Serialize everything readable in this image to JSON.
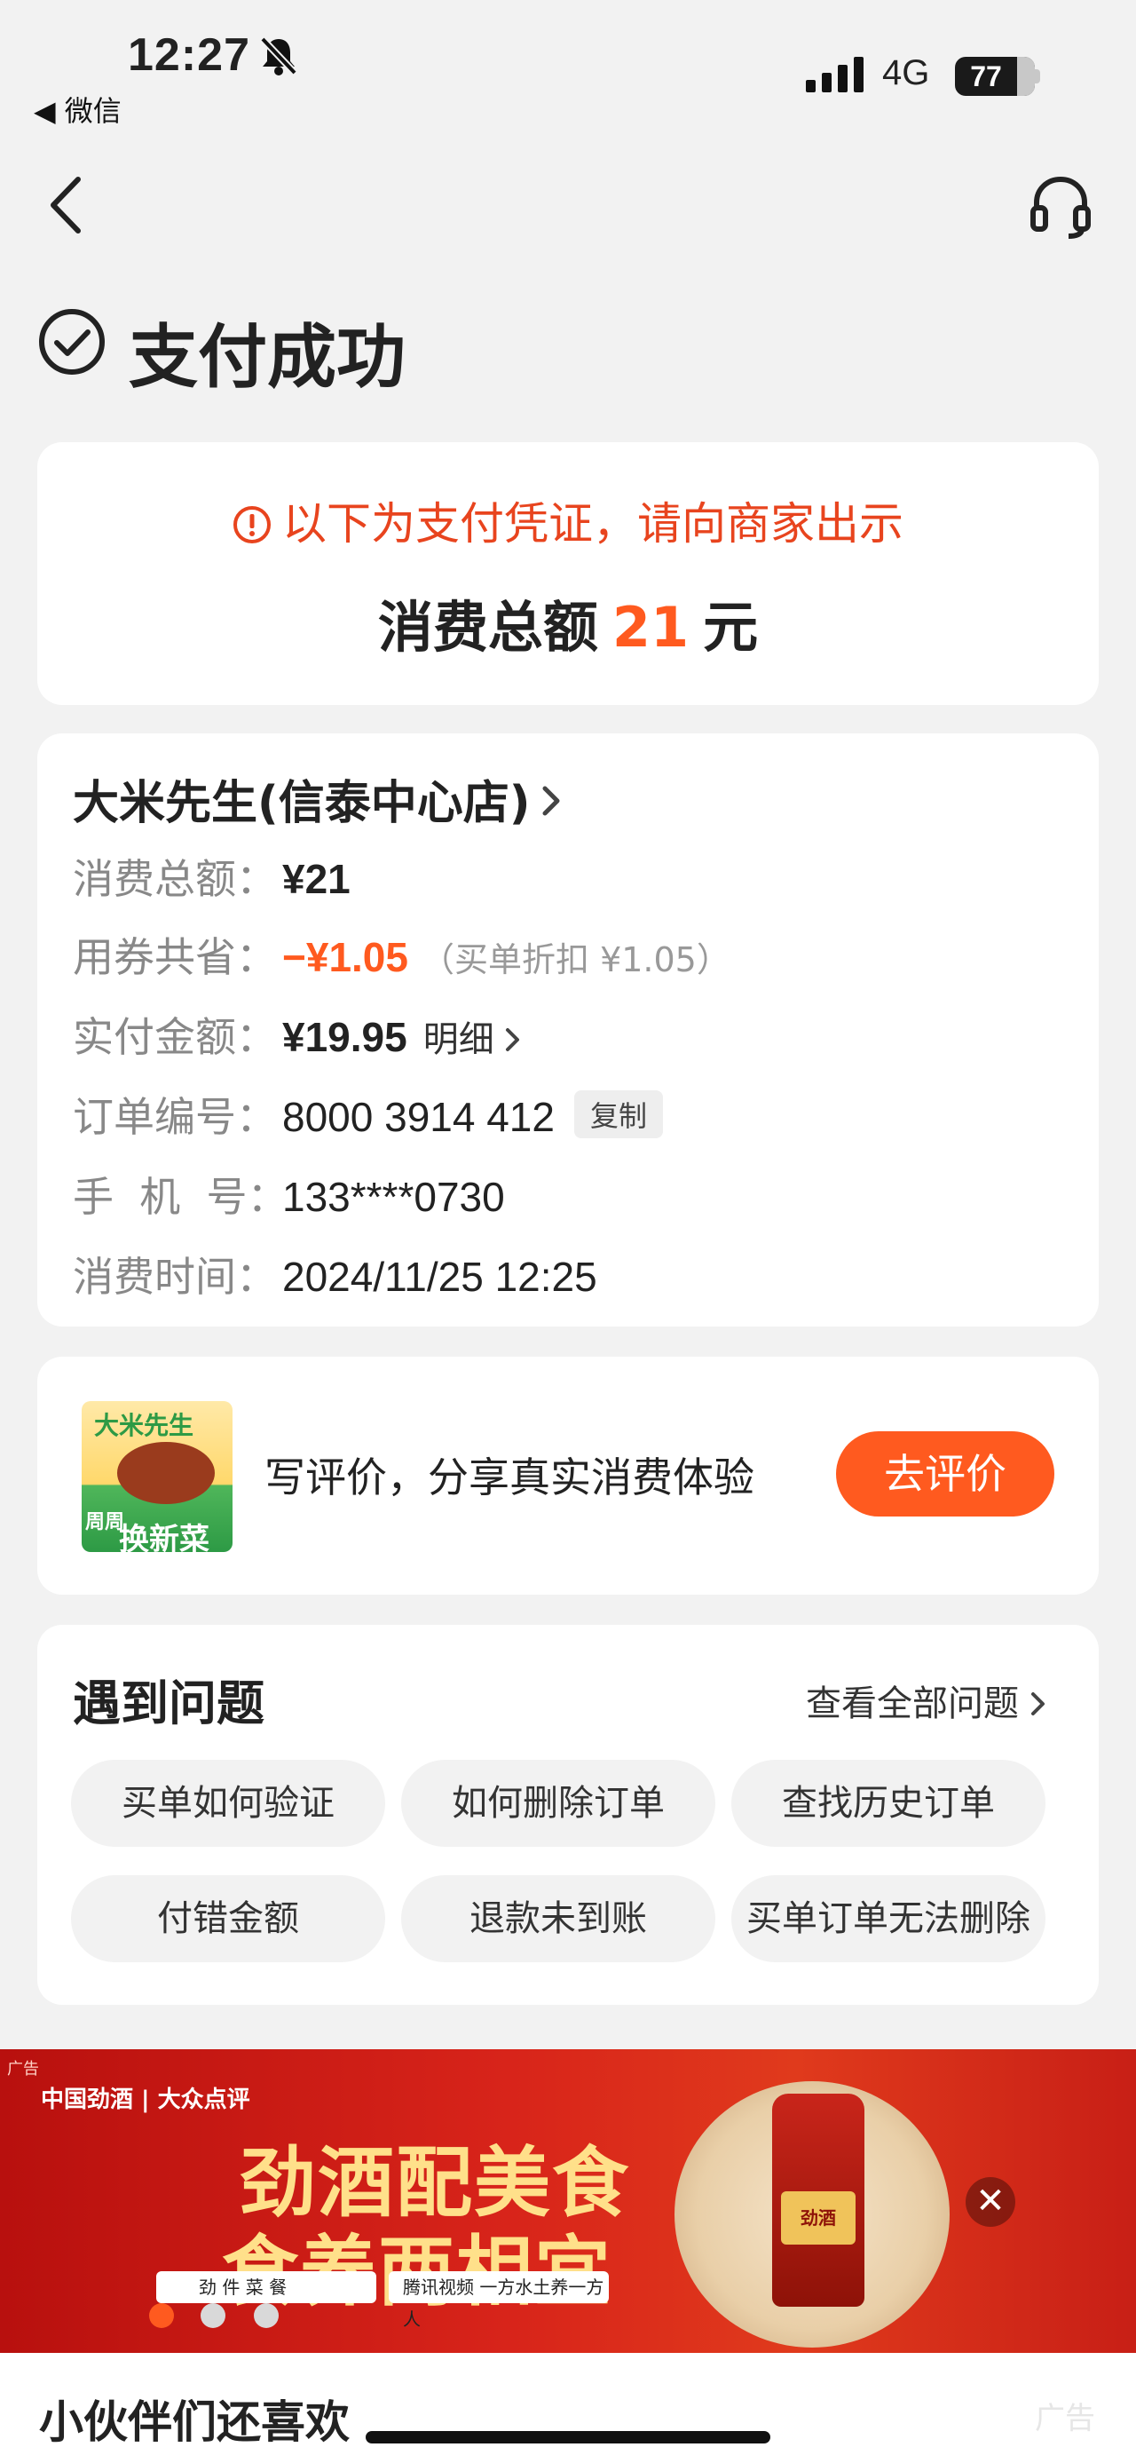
{
  "status_bar": {
    "time": "12:27",
    "back_app": "◀ 微信",
    "network": "4G",
    "battery": "77"
  },
  "page": {
    "title": "支付成功"
  },
  "voucher": {
    "notice": "以下为支付凭证，请向商家出示",
    "total_label": "消费总额",
    "total_amount": "21",
    "total_unit": "元"
  },
  "order": {
    "shop_name": "大米先生(信泰中心店)",
    "rows": {
      "total": {
        "label": "消费总额：",
        "value": "¥21"
      },
      "coupon": {
        "label": "用券共省：",
        "value": "−¥1.05",
        "note": "（买单折扣 ¥1.05）"
      },
      "paid": {
        "label": "实付金额：",
        "value": "¥19.95",
        "detail": "明细"
      },
      "order_no": {
        "label": "订单编号：",
        "value": "8000 3914 412",
        "copy": "复制"
      },
      "phone": {
        "label": "手  机  号：",
        "value": "133****0730"
      },
      "time": {
        "label": "消费时间：",
        "value": "2024/11/25 12:25"
      }
    }
  },
  "review": {
    "thumb_brand": "大米先生",
    "thumb_tag": "周周",
    "thumb_slogan": "换新菜",
    "text": "写评价，分享真实消费体验",
    "button": "去评价"
  },
  "issues": {
    "title": "遇到问题",
    "view_all": "查看全部问题",
    "chips": [
      "买单如何验证",
      "如何删除订单",
      "查找历史订单",
      "付错金额",
      "退款未到账",
      "买单订单无法删除"
    ]
  },
  "ad": {
    "tag": "广告",
    "brands": "中国劲酒 | 大众点评",
    "headline1": "劲酒配美食",
    "headline2": "食养两相宜",
    "search1": "劲 件 菜 餐",
    "search2": "腾讯视频  一方水土养一方人",
    "bottle_label": "劲酒"
  },
  "bottom": {
    "title": "小伙伴们还喜欢",
    "ad_tag": "广告"
  },
  "colors": {
    "accent": "#ff5a1f",
    "warning": "#e8441e",
    "background": "#f2f2f2"
  }
}
